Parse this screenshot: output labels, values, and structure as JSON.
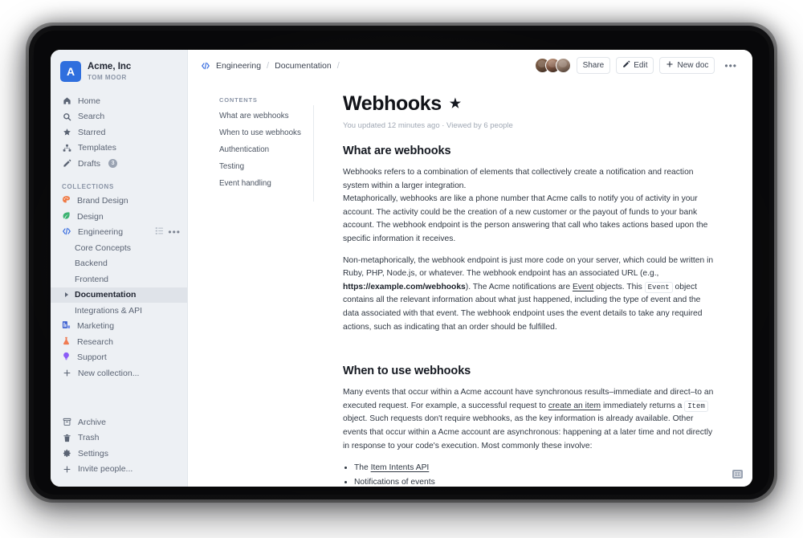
{
  "team": {
    "avatar_letter": "A",
    "name": "Acme, Inc",
    "user": "TOM MOOR"
  },
  "sidebar": {
    "nav": [
      {
        "label": "Home",
        "icon": "home-icon"
      },
      {
        "label": "Search",
        "icon": "search-icon"
      },
      {
        "label": "Starred",
        "icon": "star-icon"
      },
      {
        "label": "Templates",
        "icon": "templates-icon"
      },
      {
        "label": "Drafts",
        "icon": "pencil-icon",
        "badge": "3"
      }
    ],
    "collections_label": "COLLECTIONS",
    "collections": [
      {
        "label": "Brand Design",
        "icon": "palette-icon",
        "color": "#ef7a45"
      },
      {
        "label": "Design",
        "icon": "leaf-icon",
        "color": "#3cb371"
      },
      {
        "label": "Engineering",
        "icon": "code-icon",
        "color": "#3b6fe0",
        "has_actions": true
      }
    ],
    "engineering_docs": [
      {
        "label": "Core Concepts",
        "selected": false
      },
      {
        "label": "Backend",
        "selected": false
      },
      {
        "label": "Frontend",
        "selected": false
      },
      {
        "label": "Documentation",
        "selected": true
      },
      {
        "label": "Integrations & API",
        "selected": false
      }
    ],
    "collections_after": [
      {
        "label": "Marketing",
        "icon": "chart-icon",
        "color": "#3b5fd0"
      },
      {
        "label": "Research",
        "icon": "beaker-icon",
        "color": "#f07b52"
      },
      {
        "label": "Support",
        "icon": "lightbulb-icon",
        "color": "#8b5cf6"
      }
    ],
    "new_collection_label": "New collection...",
    "bottom": [
      {
        "label": "Archive",
        "icon": "archive-icon"
      },
      {
        "label": "Trash",
        "icon": "trash-icon"
      },
      {
        "label": "Settings",
        "icon": "gear-icon"
      },
      {
        "label": "Invite people...",
        "icon": "plus-icon"
      }
    ]
  },
  "topbar": {
    "breadcrumb": [
      {
        "label": "Engineering",
        "icon": "code-icon"
      },
      {
        "label": "Documentation",
        "icon": null
      },
      {
        "label": "",
        "icon": "toc-list-icon"
      }
    ],
    "share_label": "Share",
    "edit_label": "Edit",
    "new_doc_label": "New doc",
    "overflow_label": "•••",
    "collaborators_count": 3
  },
  "toc": {
    "heading": "CONTENTS",
    "items": [
      "What are webhooks",
      "When to use webhooks",
      "Authentication",
      "Testing",
      "Event handling"
    ]
  },
  "document": {
    "title": "Webhooks",
    "starred": true,
    "byline": "You updated 12 minutes ago · Viewed by 6 people",
    "sections": [
      {
        "heading": "What are webhooks",
        "paragraph_1": "Webhooks refers to a combination of elements that collectively create a notification and reaction system within a larger integration.",
        "paragraph_2": "Metaphorically, webhooks are like a phone number that Acme calls to notify you of activity in your account. The activity could be the creation of a new customer or the payout of funds to your bank account. The webhook endpoint is the person answering that call who takes actions based upon the specific information it receives.",
        "paragraph_3_a": "Non-metaphorically, the webhook endpoint is just more code on your server, which could be written in Ruby, PHP, Node.js, or whatever. The webhook endpoint has an associated URL (e.g., ",
        "paragraph_3_url": "https://example.com/webhooks",
        "paragraph_3_b": "). The Acme notifications are ",
        "paragraph_3_link": "Event",
        "paragraph_3_c": " objects. This ",
        "paragraph_3_code": "Event",
        "paragraph_3_d": " object contains all the relevant information about what just happened, including the type of event and the data associated with that event. The webhook endpoint uses the event details to take any required actions, such as indicating that an order should be fulfilled."
      },
      {
        "heading": "When to use webhooks",
        "paragraph_1_a": "Many events that occur within a Acme account have synchronous results–immediate and direct–to an executed request. For example, a successful request to ",
        "paragraph_1_link": "create an item",
        "paragraph_1_b": " immediately returns a ",
        "paragraph_1_code": "Item",
        "paragraph_1_c": " object. Such requests don't require webhooks, as the key information is already available. Other events that occur within a Acme account are asynchronous: happening at a later time and not directly in response to your code's execution. Most commonly these involve:",
        "bullets": [
          {
            "prefix": "The ",
            "link": "Item Intents API",
            "suffix": ""
          },
          {
            "prefix": "Notifications of events",
            "link": "",
            "suffix": ""
          }
        ]
      }
    ]
  },
  "fab": {
    "icon": "keyboard-icon"
  },
  "colors": {
    "sidebar_bg": "#edf0f4",
    "selected_row": "#dfe3e9",
    "accent_blue": "#2f6fde",
    "text_primary": "#1f2430",
    "text_muted": "#8a94a6"
  }
}
